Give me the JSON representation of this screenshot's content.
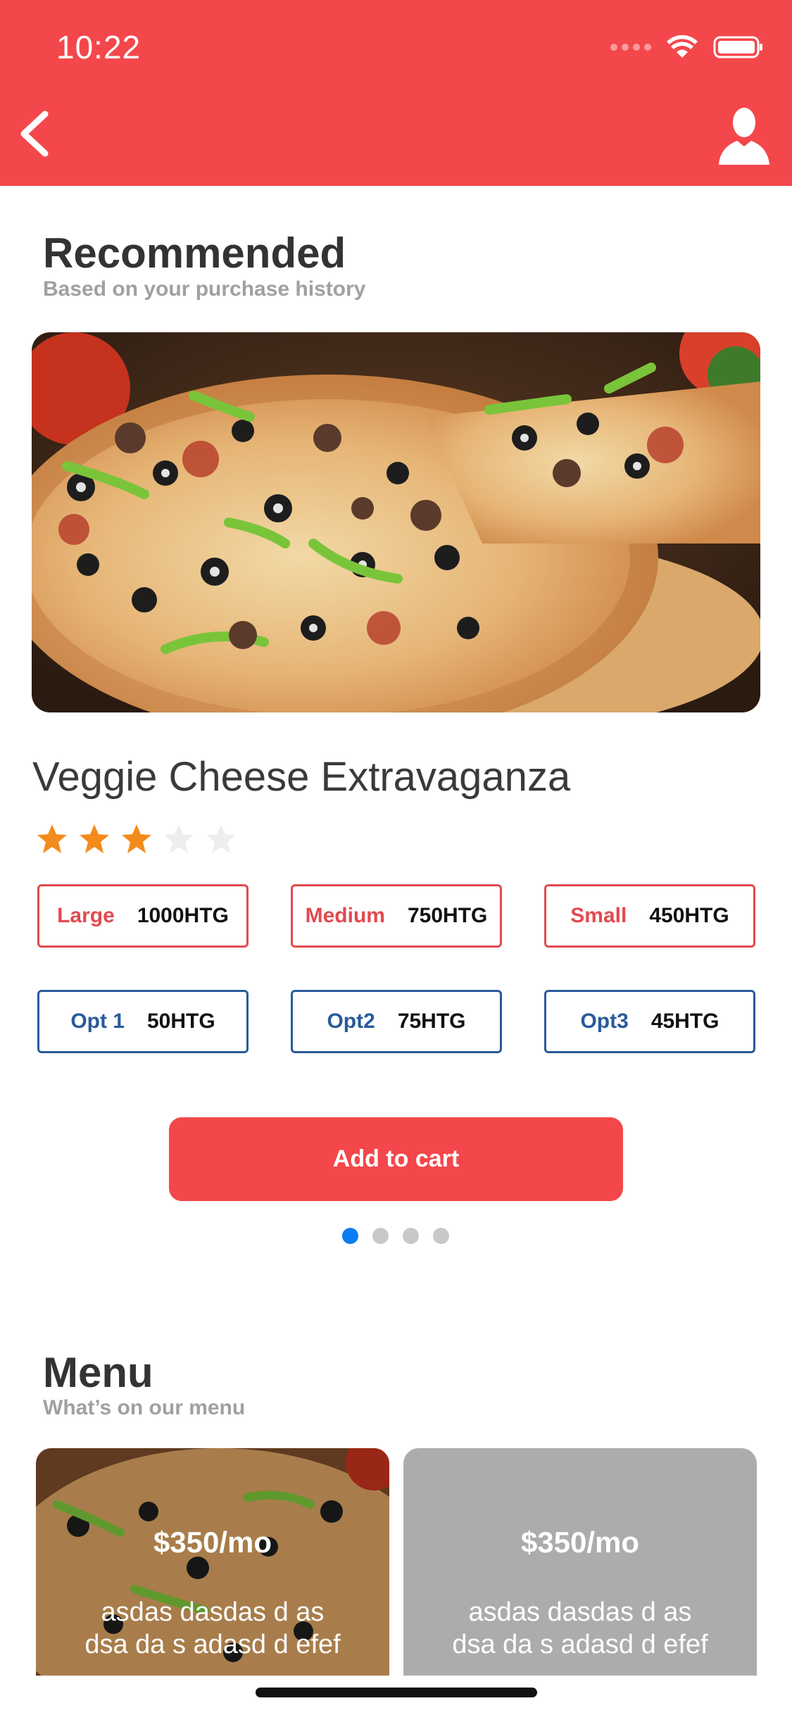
{
  "status_bar": {
    "time": "10:22"
  },
  "nav": {
    "back_icon": "chevron-left-icon",
    "user_icon": "user-icon"
  },
  "recommended": {
    "title": "Recommended",
    "subtitle": "Based on your purchase history",
    "product_name": "Veggie Cheese Extravaganza",
    "rating": 3,
    "rating_max": 5,
    "sizes": [
      {
        "label": "Large",
        "price": "1000HTG"
      },
      {
        "label": "Medium",
        "price": "750HTG"
      },
      {
        "label": "Small",
        "price": "450HTG"
      }
    ],
    "options": [
      {
        "label": "Opt 1",
        "price": "50HTG"
      },
      {
        "label": "Opt2",
        "price": "75HTG"
      },
      {
        "label": "Opt3",
        "price": "45HTG"
      }
    ],
    "add_to_cart": "Add to cart",
    "carousel_page": 1,
    "carousel_total": 4
  },
  "menu": {
    "title": "Menu",
    "subtitle": "What’s on our menu",
    "cards": [
      {
        "price": "$350/mo",
        "description": "asdas dasdas d as dsa da s adasd  d efef"
      },
      {
        "price": "$350/mo",
        "description": "asdas dasdas d as dsa da s adasd  d efef"
      }
    ]
  },
  "colors": {
    "accent": "#f4474b",
    "blue": "#2a5a9a",
    "star": "#f38b1c",
    "dot_active": "#0a7cf2"
  }
}
